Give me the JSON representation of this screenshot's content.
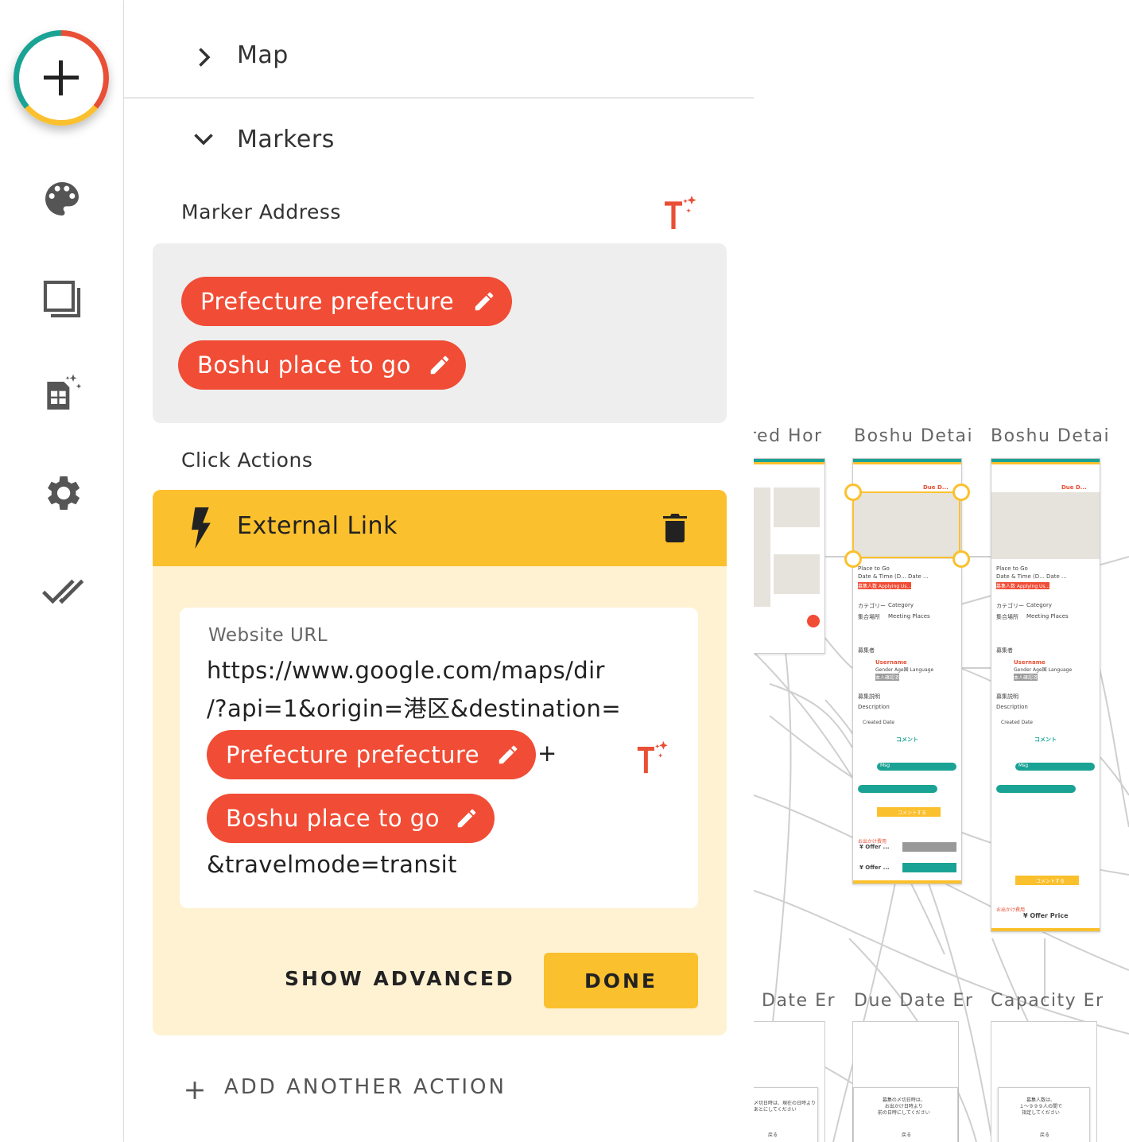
{
  "sidebar": {
    "icons": [
      "add-icon",
      "palette-icon",
      "screens-icon",
      "magic-sheet-icon",
      "gear-icon",
      "double-check-icon"
    ]
  },
  "panel": {
    "map_section": "Map",
    "markers_section": "Markers",
    "marker_address_label": "Marker Address",
    "marker_chips": [
      "Prefecture prefecture",
      "Boshu place to go"
    ],
    "click_actions_label": "Click Actions",
    "action": {
      "title": "External Link",
      "url_label": "Website URL",
      "url_line1": "https://www.google.com/maps/dir",
      "url_line2": "/?api=1&origin=港区&destination=",
      "url_chip1": "Prefecture prefecture",
      "url_plus": "+",
      "url_chip2": "Boshu place to go",
      "url_suffix": "&travelmode=transit",
      "show_advanced": "SHOW ADVANCED",
      "done": "DONE"
    },
    "add_another": "ADD ANOTHER ACTION"
  },
  "canvas": {
    "screens": [
      {
        "title": "red Hor"
      },
      {
        "title": "Boshu Detai"
      },
      {
        "title": "Boshu Detai"
      }
    ],
    "error_screens": [
      {
        "title": "Date Er"
      },
      {
        "title": "Due Date Er"
      },
      {
        "title": "Capacity Er"
      }
    ],
    "phone": {
      "due": "Due D...",
      "place": "Place to Go",
      "datetime": "Date & Time (D... Date ...",
      "applying": "募集人数 Applying Us...",
      "category_jp": "カテゴリー",
      "category": "Category",
      "meeting_jp": "集合場所",
      "meeting": "Meeting Places",
      "organizer_jp": "募集者",
      "username": "Username",
      "gender": "Gender Age国 Language",
      "verified": "本人確認済",
      "desc_jp": "募集説明",
      "description": "Description",
      "created": "Created Date",
      "comment": "コメント",
      "msg": "Msg",
      "comment_btn": "コメントする",
      "offer_label": "お出かけ費用",
      "offer": "¥ Offer ...",
      "offer_price": "¥ Offer Price"
    },
    "error_texts": [
      "〆切日時は、現在の日時より\nあとにしてください",
      "募集の〆切日時は、\nお出かけ日時より\n前の日時にしてください",
      "募集人数は、\n１～９９９人の間で\n指定してください"
    ],
    "error_ok": "戻る"
  },
  "colors": {
    "accent_red": "#f14c35",
    "accent_yellow": "#fbc02d",
    "card_bg": "#fff2d3",
    "teal": "#1aa394"
  }
}
